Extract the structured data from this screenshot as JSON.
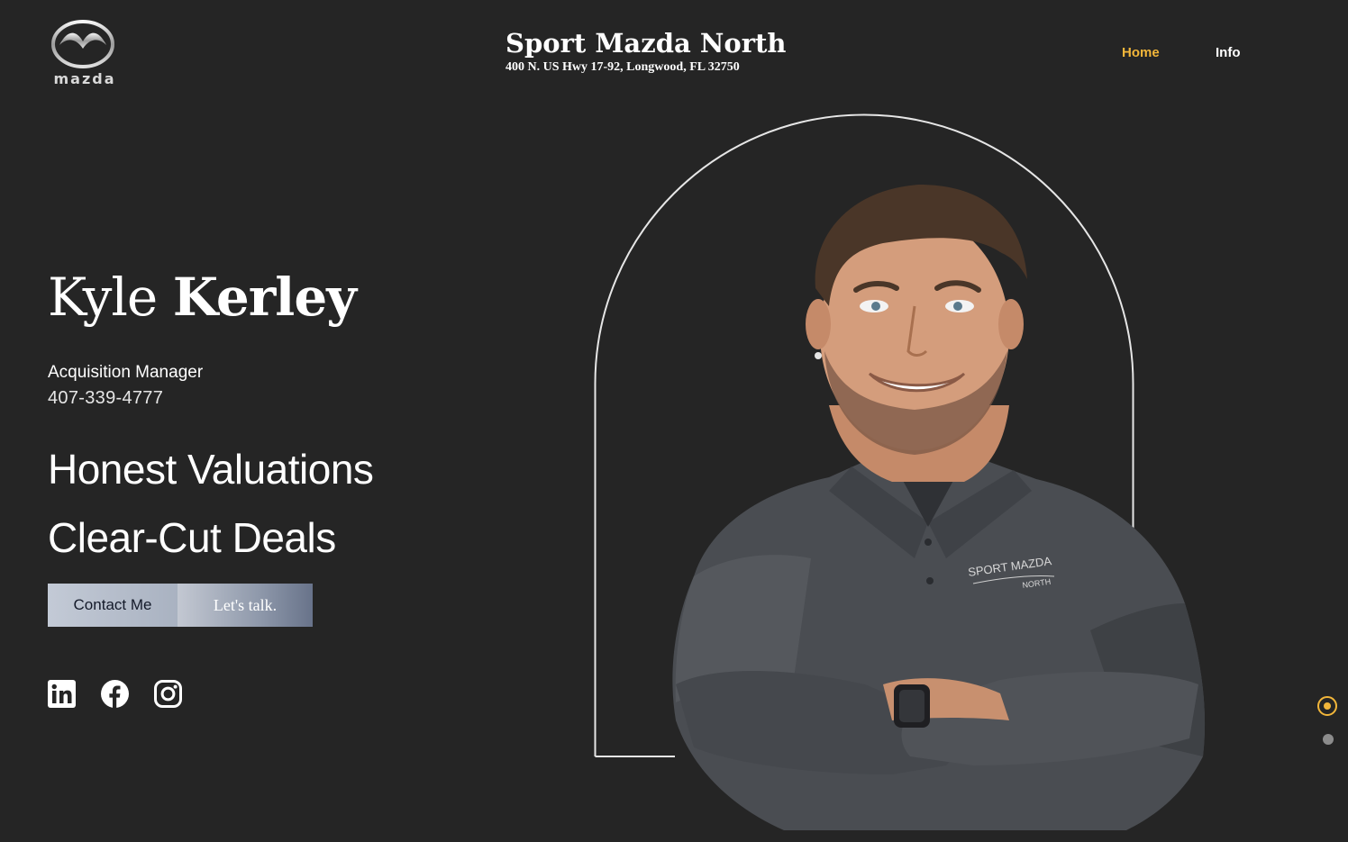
{
  "header": {
    "logo_word": "mazda",
    "dealer_name": "Sport Mazda North",
    "dealer_address": "400 N. US Hwy 17-92, Longwood, FL 32750",
    "nav": [
      {
        "label": "Home",
        "active": true
      },
      {
        "label": "Info",
        "active": false
      }
    ]
  },
  "hero": {
    "first_name": "Kyle",
    "last_name": "Kerley",
    "job_title": "Acquisition Manager",
    "phone": "407-339-4777",
    "tagline_1": "Honest Valuations",
    "tagline_2": "Clear-Cut Deals",
    "contact_label": "Contact Me",
    "talk_label": "Let's talk.",
    "portrait_shirt_text_1": "SPORT MAZDA",
    "portrait_shirt_text_2": "NORTH"
  },
  "social": [
    "linkedin-icon",
    "facebook-icon",
    "instagram-icon"
  ],
  "slides": {
    "count": 2,
    "active": 1
  },
  "colors": {
    "background": "#252525",
    "accent": "#f2b63a",
    "text": "#ffffff",
    "button_start": "#c3cad6",
    "button_end": "#68738a"
  }
}
